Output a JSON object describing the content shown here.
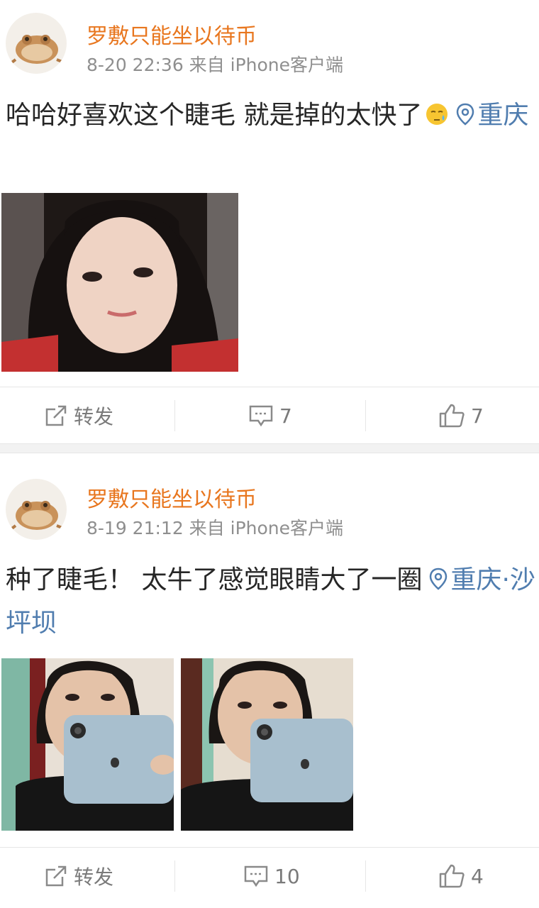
{
  "posts": [
    {
      "username": "罗敷只能坐以待币",
      "meta": "8-20 22:36 来自 iPhone客户端",
      "text": "哈哈好喜欢这个睫毛 就是掉的太快了",
      "location": "重庆",
      "actions": {
        "repost_label": "转发",
        "comment_count": "7",
        "like_count": "7"
      }
    },
    {
      "username": "罗敷只能坐以待币",
      "meta": "8-19 21:12 来自 iPhone客户端",
      "text": "种了睫毛！ 太牛了感觉眼睛大了一圈",
      "location": "重庆·沙坪坝",
      "actions": {
        "repost_label": "转发",
        "comment_count": "10",
        "like_count": "4"
      }
    }
  ],
  "colors": {
    "username": "#e8761e",
    "link": "#507daf",
    "meta": "#8f8f8f"
  },
  "icons": [
    "frog-avatar-icon",
    "location-pin-icon",
    "sad-emoji-icon",
    "repost-icon",
    "comment-icon",
    "like-icon"
  ]
}
